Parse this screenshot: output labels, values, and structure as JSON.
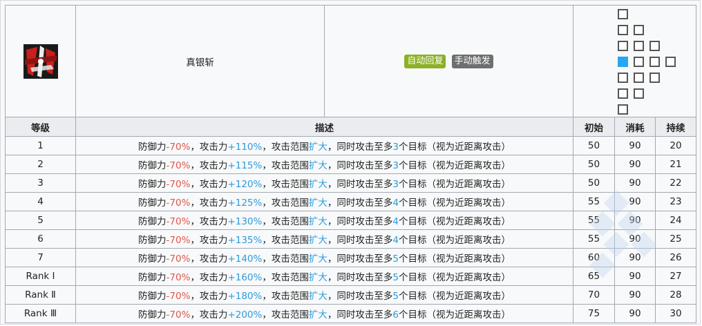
{
  "skill": {
    "name": "真银斩",
    "tags": [
      {
        "label": "自动回复",
        "color": "#8cb027"
      },
      {
        "label": "手动触发",
        "color": "#6f6f6f"
      }
    ],
    "icon": "skill-icon-red-black-blades"
  },
  "range_grid": {
    "cells": [
      {
        "col": 0,
        "row": 0
      },
      {
        "col": 0,
        "row": 1
      },
      {
        "col": 1,
        "row": 1
      },
      {
        "col": 0,
        "row": 2
      },
      {
        "col": 1,
        "row": 2
      },
      {
        "col": 2,
        "row": 2
      },
      {
        "col": 0,
        "row": 3,
        "self": true
      },
      {
        "col": 1,
        "row": 3
      },
      {
        "col": 2,
        "row": 3
      },
      {
        "col": 3,
        "row": 3
      },
      {
        "col": 0,
        "row": 4
      },
      {
        "col": 1,
        "row": 4
      },
      {
        "col": 2,
        "row": 4
      },
      {
        "col": 0,
        "row": 5
      },
      {
        "col": 1,
        "row": 5
      },
      {
        "col": 0,
        "row": 6
      }
    ],
    "self_color": "#27a6f2"
  },
  "table": {
    "headers": {
      "level": "等级",
      "desc": "描述",
      "initial": "初始",
      "cost": "消耗",
      "duration": "持续"
    },
    "rows": [
      {
        "level": "1",
        "def": "-70%",
        "atk": "+110%",
        "range": "扩大",
        "targets": "3",
        "initial": "50",
        "cost": "90",
        "duration": "20"
      },
      {
        "level": "2",
        "def": "-70%",
        "atk": "+115%",
        "range": "扩大",
        "targets": "3",
        "initial": "50",
        "cost": "90",
        "duration": "21"
      },
      {
        "level": "3",
        "def": "-70%",
        "atk": "+120%",
        "range": "扩大",
        "targets": "3",
        "initial": "50",
        "cost": "90",
        "duration": "22"
      },
      {
        "level": "4",
        "def": "-70%",
        "atk": "+125%",
        "range": "扩大",
        "targets": "4",
        "initial": "55",
        "cost": "90",
        "duration": "23"
      },
      {
        "level": "5",
        "def": "-70%",
        "atk": "+130%",
        "range": "扩大",
        "targets": "4",
        "initial": "55",
        "cost": "90",
        "duration": "24"
      },
      {
        "level": "6",
        "def": "-70%",
        "atk": "+135%",
        "range": "扩大",
        "targets": "4",
        "initial": "55",
        "cost": "90",
        "duration": "25"
      },
      {
        "level": "7",
        "def": "-70%",
        "atk": "+140%",
        "range": "扩大",
        "targets": "5",
        "initial": "60",
        "cost": "90",
        "duration": "26"
      },
      {
        "level": "Rank Ⅰ",
        "def": "-70%",
        "atk": "+160%",
        "range": "扩大",
        "targets": "5",
        "initial": "65",
        "cost": "90",
        "duration": "27"
      },
      {
        "level": "Rank Ⅱ",
        "def": "-70%",
        "atk": "+180%",
        "range": "扩大",
        "targets": "5",
        "initial": "70",
        "cost": "90",
        "duration": "28"
      },
      {
        "level": "Rank Ⅲ",
        "def": "-70%",
        "atk": "+200%",
        "range": "扩大",
        "targets": "6",
        "initial": "75",
        "cost": "90",
        "duration": "30"
      }
    ],
    "desc_parts": {
      "p1": "防御力",
      "p2": "，攻击力",
      "p3": "，攻击范围",
      "p4": "，同时攻击至多",
      "p5": "个目标（视为近距离攻击）"
    }
  },
  "colors": {
    "negative": "#e0564a",
    "positive": "#2c9adb"
  }
}
